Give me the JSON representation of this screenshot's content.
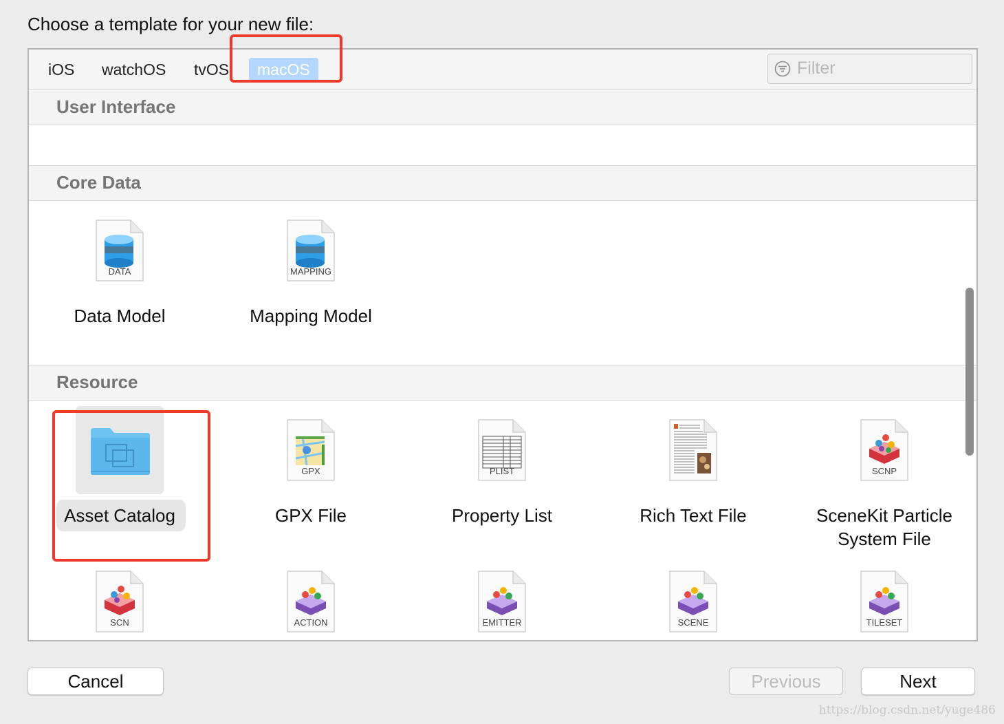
{
  "window": {
    "title": "Choose a template for your new file:"
  },
  "tabs": [
    {
      "label": "iOS",
      "selected": false
    },
    {
      "label": "watchOS",
      "selected": false
    },
    {
      "label": "tvOS",
      "selected": false
    },
    {
      "label": "macOS",
      "selected": true
    }
  ],
  "filter": {
    "placeholder": "Filter",
    "value": ""
  },
  "sections": {
    "user_interface": {
      "title": "User Interface"
    },
    "core_data": {
      "title": "Core Data",
      "items": [
        {
          "name": "Data Model",
          "icon_label": "DATA",
          "icon": "database-document-icon"
        },
        {
          "name": "Mapping Model",
          "icon_label": "MAPPING",
          "icon": "database-document-icon"
        }
      ]
    },
    "resource": {
      "title": "Resource",
      "items": [
        {
          "name": "Asset Catalog",
          "icon_label": "",
          "icon": "folder-icon",
          "selected": true
        },
        {
          "name": "GPX File",
          "icon_label": "GPX",
          "icon": "map-document-icon"
        },
        {
          "name": "Property List",
          "icon_label": "PLIST",
          "icon": "table-document-icon"
        },
        {
          "name": "Rich Text File",
          "icon_label": "",
          "icon": "text-document-icon"
        },
        {
          "name": "SceneKit Particle",
          "name_line2": "System File",
          "icon_label": "SCNP",
          "icon": "scenekit-document-icon"
        }
      ],
      "row2": [
        {
          "icon_label": "SCN",
          "icon": "scenekit-document-icon"
        },
        {
          "icon_label": "ACTION",
          "icon": "spritekit-document-icon"
        },
        {
          "icon_label": "EMITTER",
          "icon": "spritekit-document-icon"
        },
        {
          "icon_label": "SCENE",
          "icon": "spritekit-document-icon"
        },
        {
          "icon_label": "TILESET",
          "icon": "spritekit-document-icon"
        }
      ]
    }
  },
  "buttons": {
    "cancel": "Cancel",
    "previous": "Previous",
    "next": "Next"
  },
  "watermark": "https://blog.csdn.net/yuge486",
  "colors": {
    "accent": "#b3d7ff",
    "highlight": "#ee3a2a"
  }
}
